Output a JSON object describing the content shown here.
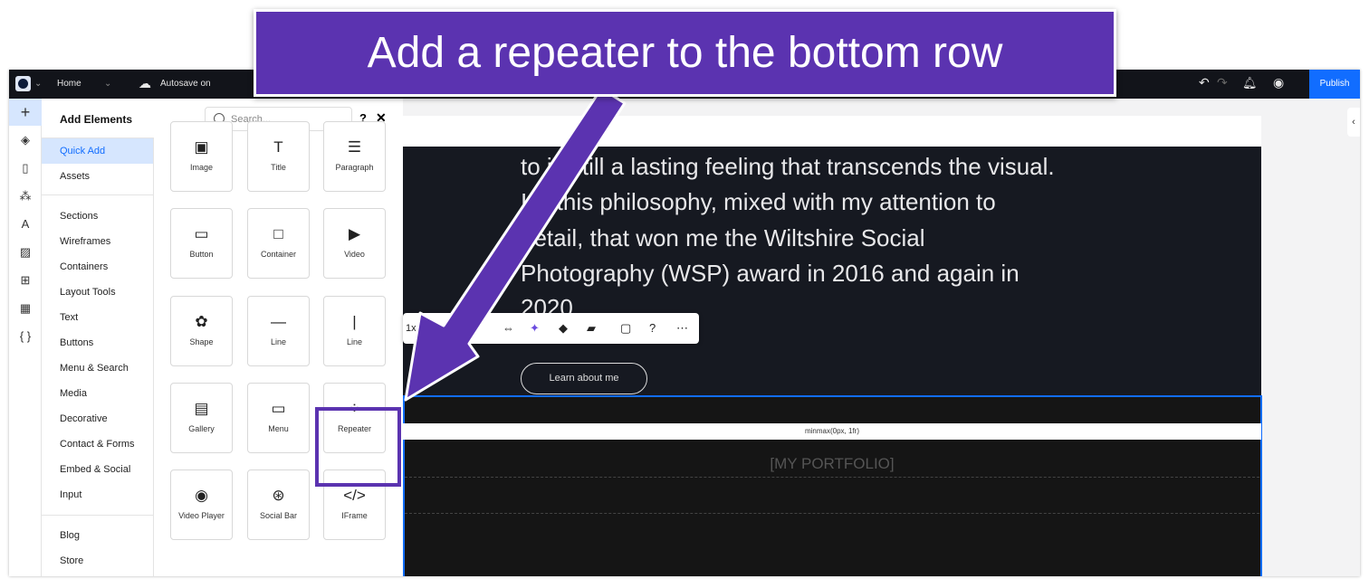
{
  "annotation": {
    "text": "Add a repeater to the bottom row",
    "color": "#5b33b0"
  },
  "topbar": {
    "page": "Home",
    "autosave": "Autosave on",
    "publish": "Publish"
  },
  "panel": {
    "title": "Add Elements",
    "search_placeholder": "Search...",
    "help": "?",
    "close": "✕",
    "categories": [
      "Quick Add",
      "Assets",
      "Sections",
      "Wireframes",
      "Containers",
      "Layout Tools",
      "Text",
      "Buttons",
      "Menu & Search",
      "Media",
      "Decorative",
      "Contact & Forms",
      "Embed & Social",
      "Input",
      "Blog",
      "Store"
    ],
    "tiles": [
      {
        "label": "Image",
        "icon": "▣"
      },
      {
        "label": "Title",
        "icon": "T"
      },
      {
        "label": "Paragraph",
        "icon": "☰"
      },
      {
        "label": "Button",
        "icon": "▭"
      },
      {
        "label": "Container",
        "icon": "□"
      },
      {
        "label": "Video",
        "icon": "▶"
      },
      {
        "label": "Shape",
        "icon": "✿"
      },
      {
        "label": "Line",
        "icon": "—"
      },
      {
        "label": "Line",
        "icon": "|"
      },
      {
        "label": "Gallery",
        "icon": "▤"
      },
      {
        "label": "Menu",
        "icon": "▭"
      },
      {
        "label": "Repeater",
        "icon": "⁘"
      },
      {
        "label": "Video Player",
        "icon": "◉"
      },
      {
        "label": "Social Bar",
        "icon": "⊛"
      },
      {
        "label": "IFrame",
        "icon": "</>"
      }
    ]
  },
  "canvas": {
    "lines": [
      "to is still a lasting feeling that transcends the visual.",
      "It's this philosophy, mixed with my attention to",
      "detail, that won me the Wiltshire Social",
      "Photography (WSP) award in 2016 and again in",
      "2020."
    ],
    "button": "Learn about me",
    "grid_label": "minmax(0px, 1fr)",
    "section_title": "[MY PORTFOLIO]",
    "toolbar_layout": "1x2"
  }
}
